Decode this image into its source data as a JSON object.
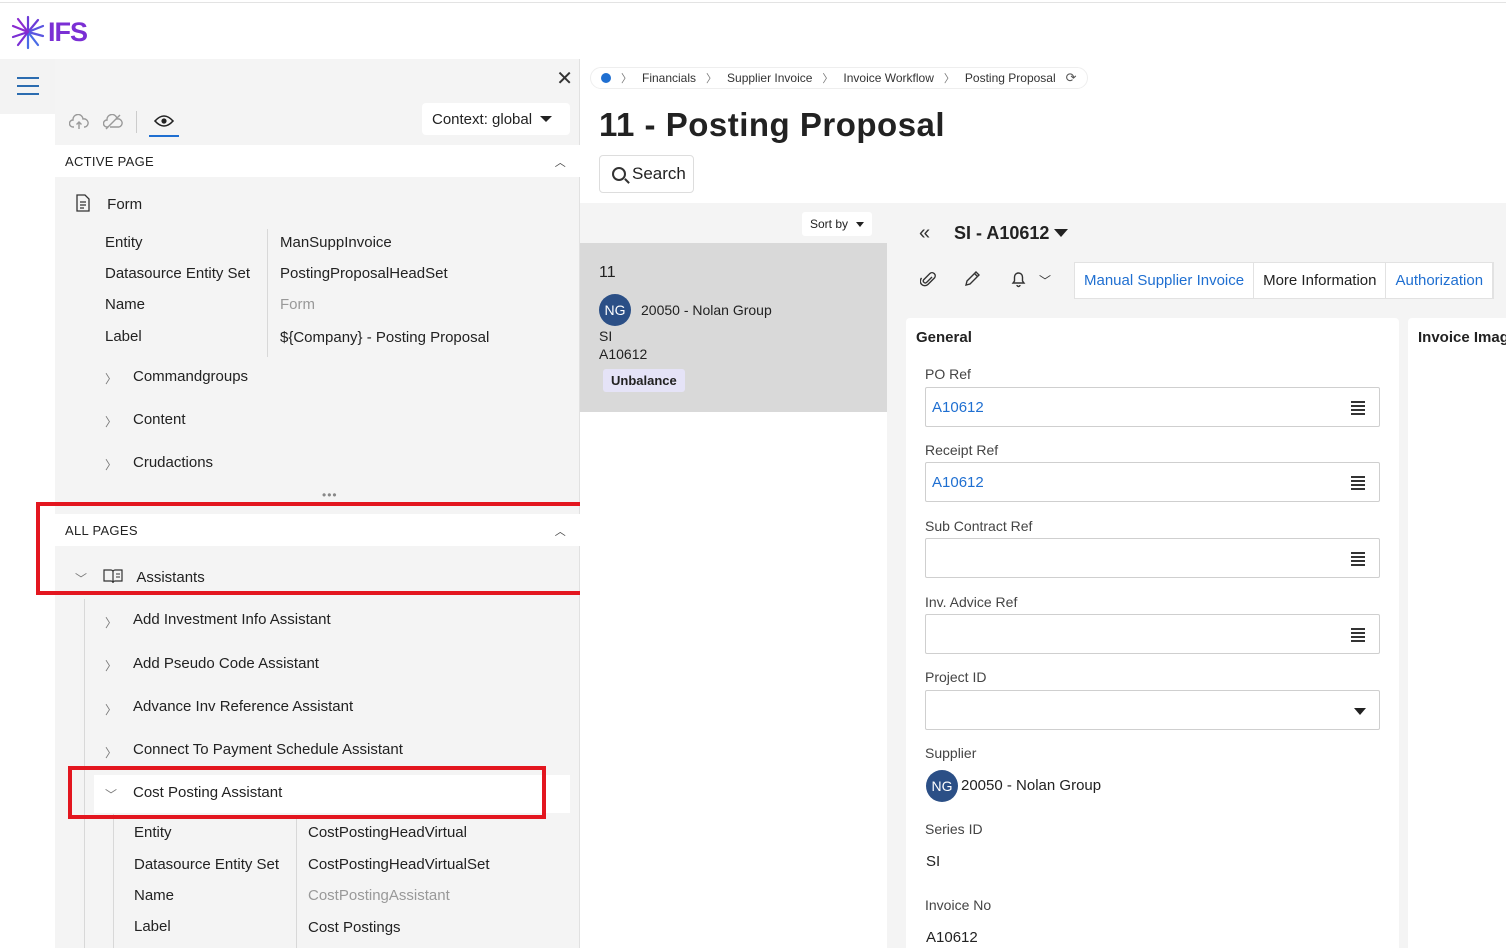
{
  "app": {
    "logo_text": "IFS"
  },
  "panel": {
    "context_label": "Context: global",
    "active_page": {
      "header": "ACTIVE PAGE",
      "node_label": "Form",
      "properties": [
        {
          "label": "Entity",
          "value": "ManSuppInvoice",
          "muted": false
        },
        {
          "label": "Datasource Entity Set",
          "value": "PostingProposalHeadSet",
          "muted": false
        },
        {
          "label": "Name",
          "value": "Form",
          "muted": true
        },
        {
          "label": "Label",
          "value": "${Company} - Posting Proposal",
          "muted": false
        }
      ],
      "children": [
        "Commandgroups",
        "Content",
        "Crudactions"
      ]
    },
    "all_pages": {
      "header": "ALL PAGES",
      "group_label": "Assistants",
      "items": [
        "Add Investment Info Assistant",
        "Add Pseudo Code Assistant",
        "Advance Inv Reference Assistant",
        "Connect To Payment Schedule Assistant",
        "Cost Posting Assistant"
      ],
      "expanded_properties": [
        {
          "label": "Entity",
          "value": "CostPostingHeadVirtual",
          "muted": false
        },
        {
          "label": "Datasource Entity Set",
          "value": "CostPostingHeadVirtualSet",
          "muted": false
        },
        {
          "label": "Name",
          "value": "CostPostingAssistant",
          "muted": true
        },
        {
          "label": "Label",
          "value": "Cost Postings",
          "muted": false
        }
      ]
    }
  },
  "breadcrumb": [
    "Financials",
    "Supplier Invoice",
    "Invoice Workflow",
    "Posting Proposal"
  ],
  "page_title": "11 - Posting Proposal",
  "search_label": "Search",
  "list": {
    "sort_label": "Sort by",
    "card": {
      "id": "11",
      "avatar": "NG",
      "supplier": "20050 - Nolan Group",
      "series": "SI",
      "invoice": "A10612",
      "badge": "Unbalance"
    }
  },
  "detail": {
    "record_title": "SI - A10612",
    "tabs": [
      "Manual Supplier Invoice",
      "More Information",
      "Authorization"
    ],
    "general": {
      "title": "General",
      "po_ref_label": "PO Ref",
      "po_ref_value": "A10612",
      "receipt_ref_label": "Receipt Ref",
      "receipt_ref_value": "A10612",
      "sub_contract_label": "Sub Contract Ref",
      "inv_advice_label": "Inv. Advice Ref",
      "project_label": "Project ID",
      "supplier_label": "Supplier",
      "supplier_avatar": "NG",
      "supplier_value": "20050 - Nolan Group",
      "series_label": "Series ID",
      "series_value": "SI",
      "invoice_no_label": "Invoice No",
      "invoice_no_value": "A10612"
    },
    "image_card_title": "Invoice Imag"
  },
  "colors": {
    "brand": "#7b2fd4",
    "link": "#1f6fd1",
    "highlight": "#e3161f",
    "avatar": "#2b4f86"
  }
}
